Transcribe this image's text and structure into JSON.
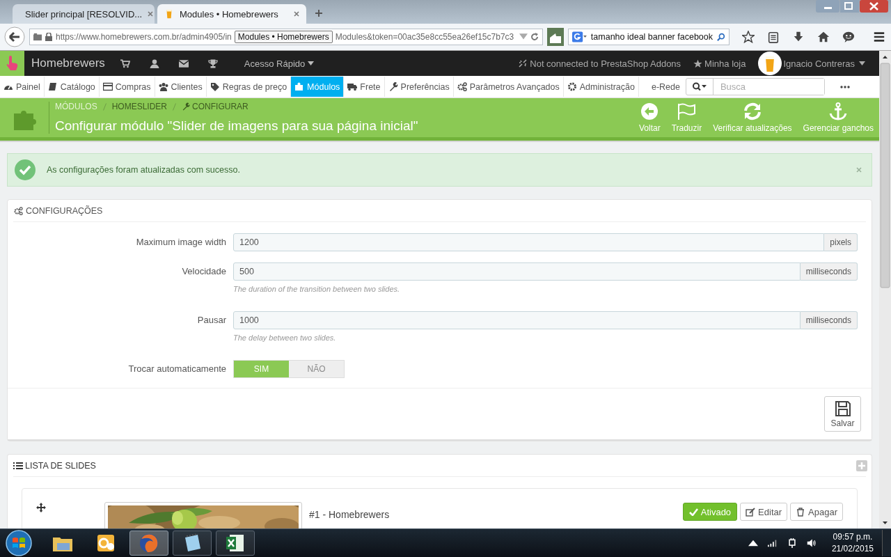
{
  "browser": {
    "tabs": [
      {
        "title": "Slider principal [RESOLVID...",
        "selected": false
      },
      {
        "title": "Modules • Homebrewers",
        "selected": true
      }
    ],
    "url_start": "https://www.homebrewers.com.br/admin4905/in",
    "url_tooltip": "Modules • Homebrewers",
    "url_end": "Modules&token=00ac35e8cc55ea26ef15c7b7c3",
    "search_value": "tamanho ideal banner facebook"
  },
  "admin_header": {
    "shop_name": "Homebrewers",
    "quick_access": "Acesso Rápido",
    "addons_status": "Not connected to PrestaShop Addons",
    "my_store": "Minha loja",
    "user_name": "Ignacio Contreras"
  },
  "menu": {
    "items": [
      {
        "label": "Painel",
        "selected": false
      },
      {
        "label": "Catálogo",
        "selected": false
      },
      {
        "label": "Compras",
        "selected": false
      },
      {
        "label": "Clientes",
        "selected": false
      },
      {
        "label": "Regras de preço",
        "selected": false
      },
      {
        "label": "Módulos",
        "selected": true
      },
      {
        "label": "Frete",
        "selected": false
      },
      {
        "label": "Preferências",
        "selected": false
      },
      {
        "label": "Parâmetros Avançados",
        "selected": false
      },
      {
        "label": "Administração",
        "selected": false
      }
    ],
    "extra_link": "e-Rede",
    "search_placeholder": "Busca"
  },
  "toolbar": {
    "breadcrumb": [
      "MÓDULOS",
      "HOMESLIDER",
      "CONFIGURAR"
    ],
    "title": "Configurar módulo \"Slider de imagens para sua página inicial\"",
    "actions": [
      "Voltar",
      "Traduzir",
      "Verificar atualizações",
      "Gerenciar ganchos"
    ]
  },
  "alert": {
    "message": "As configurações foram atualizadas com sucesso."
  },
  "config_panel": {
    "heading": "CONFIGURAÇÕES",
    "fields": [
      {
        "label": "Maximum image width",
        "value": "1200",
        "unit": "pixels"
      },
      {
        "label": "Velocidade",
        "value": "500",
        "unit": "milliseconds",
        "help": "The duration of the transition between two slides."
      },
      {
        "label": "Pausar",
        "value": "1000",
        "unit": "milliseconds",
        "help": "The delay between two slides."
      }
    ],
    "toggle": {
      "label": "Trocar automaticamente",
      "options": [
        {
          "label": "SIM",
          "selected": true
        },
        {
          "label": "NÃO",
          "selected": false
        }
      ]
    },
    "save_button": "Salvar"
  },
  "slides_panel": {
    "heading": "LISTA DE SLIDES",
    "slides": [
      {
        "title": "#1 - Homebrewers",
        "status": "Ativado",
        "enabled": true,
        "buttons": [
          "Editar",
          "Apagar"
        ]
      }
    ]
  },
  "taskbar": {
    "apps": [
      {
        "running": false,
        "selected": false
      },
      {
        "running": false,
        "selected": false
      },
      {
        "running": true,
        "selected": true
      },
      {
        "running": true,
        "selected": false
      },
      {
        "running": true,
        "selected": false
      }
    ],
    "time": "09:57 p.m.",
    "date": "21/02/2015"
  }
}
